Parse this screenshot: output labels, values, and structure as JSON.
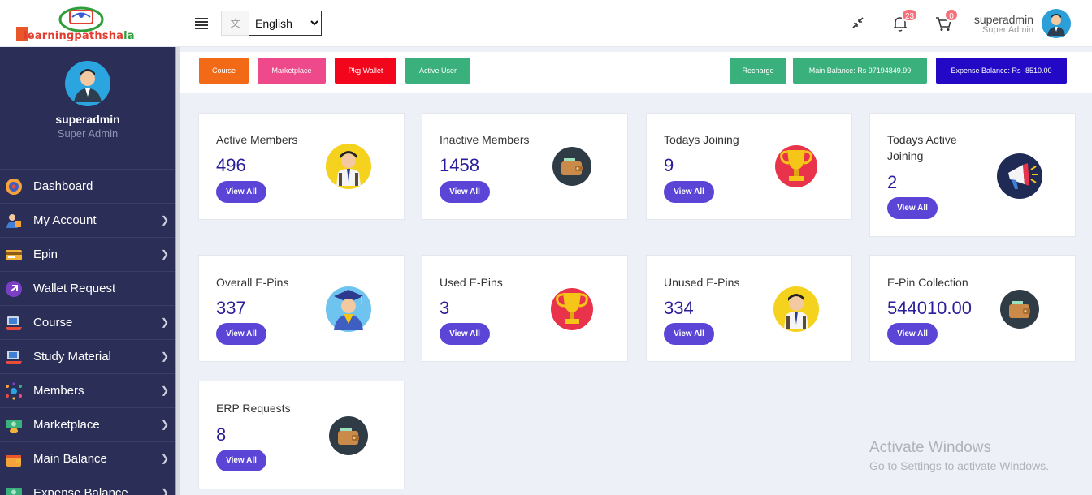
{
  "header": {
    "logo_text": "Elearningpathshala",
    "language_selected": "English",
    "notifications_count": "23",
    "cart_count": "0",
    "user_name": "superadmin",
    "user_role": "Super Admin",
    "icons": [
      "menu-icon",
      "language-icon",
      "collapse-icon",
      "bell-icon",
      "cart-icon",
      "avatar"
    ]
  },
  "sidebar": {
    "profile_name": "superadmin",
    "profile_role": "Super Admin",
    "items": [
      {
        "label": "Dashboard",
        "icon": "dashboard-icon",
        "chevron": false
      },
      {
        "label": "My Account",
        "icon": "account-icon",
        "chevron": true
      },
      {
        "label": "Epin",
        "icon": "epin-icon",
        "chevron": true
      },
      {
        "label": "Wallet Request",
        "icon": "wallet-request-icon",
        "chevron": false
      },
      {
        "label": "Course",
        "icon": "course-icon",
        "chevron": true
      },
      {
        "label": "Study Material",
        "icon": "study-material-icon",
        "chevron": true
      },
      {
        "label": "Members",
        "icon": "members-icon",
        "chevron": true
      },
      {
        "label": "Marketplace",
        "icon": "marketplace-icon",
        "chevron": true
      },
      {
        "label": "Main Balance",
        "icon": "main-balance-icon",
        "chevron": true
      },
      {
        "label": "Expense Balance",
        "icon": "expense-balance-icon",
        "chevron": true
      }
    ]
  },
  "action_bar": {
    "course": "Course",
    "marketplace": "Marketplace",
    "pkg_wallet": "Pkg Wallet",
    "active_user": "Active User",
    "recharge": "Recharge",
    "main_balance": "Main Balance: Rs 97194849.99",
    "expense_balance": "Expense Balance: Rs -8510.00"
  },
  "cards": [
    {
      "title": "Active Members",
      "value": "496",
      "button": "View All",
      "icon": "student-icon"
    },
    {
      "title": "Inactive Members",
      "value": "1458",
      "button": "View All",
      "icon": "wallet-icon"
    },
    {
      "title": "Todays Joining",
      "value": "9",
      "button": "View All",
      "icon": "trophy-icon"
    },
    {
      "title": "Todays Active Joining",
      "value": "2",
      "button": "View All",
      "icon": "megaphone-icon"
    },
    {
      "title": "Overall E-Pins",
      "value": "337",
      "button": "View All",
      "icon": "graduate-icon"
    },
    {
      "title": "Used E-Pins",
      "value": "3",
      "button": "View All",
      "icon": "trophy-icon"
    },
    {
      "title": "Unused E-Pins",
      "value": "334",
      "button": "View All",
      "icon": "student-icon"
    },
    {
      "title": "E-Pin Collection",
      "value": "544010.00",
      "button": "View All",
      "icon": "wallet-icon"
    },
    {
      "title": "ERP Requests",
      "value": "8",
      "button": "View All",
      "icon": "wallet-icon"
    }
  ],
  "watermark": {
    "line1": "Activate Windows",
    "line2": "Go to Settings to activate Windows."
  },
  "colors": {
    "sidebar_bg": "#2b2f57",
    "accent": "#5b45d6",
    "value_text": "#2a1e9b",
    "course_btn": "#f26a15",
    "marketplace_btn": "#ee4a8b",
    "pkg_wallet_btn": "#f3061b",
    "active_user_btn": "#3ab07c",
    "recharge_btn": "#3ab07c",
    "main_balance_btn": "#3ab07c",
    "expense_balance_btn": "#2308c6"
  }
}
